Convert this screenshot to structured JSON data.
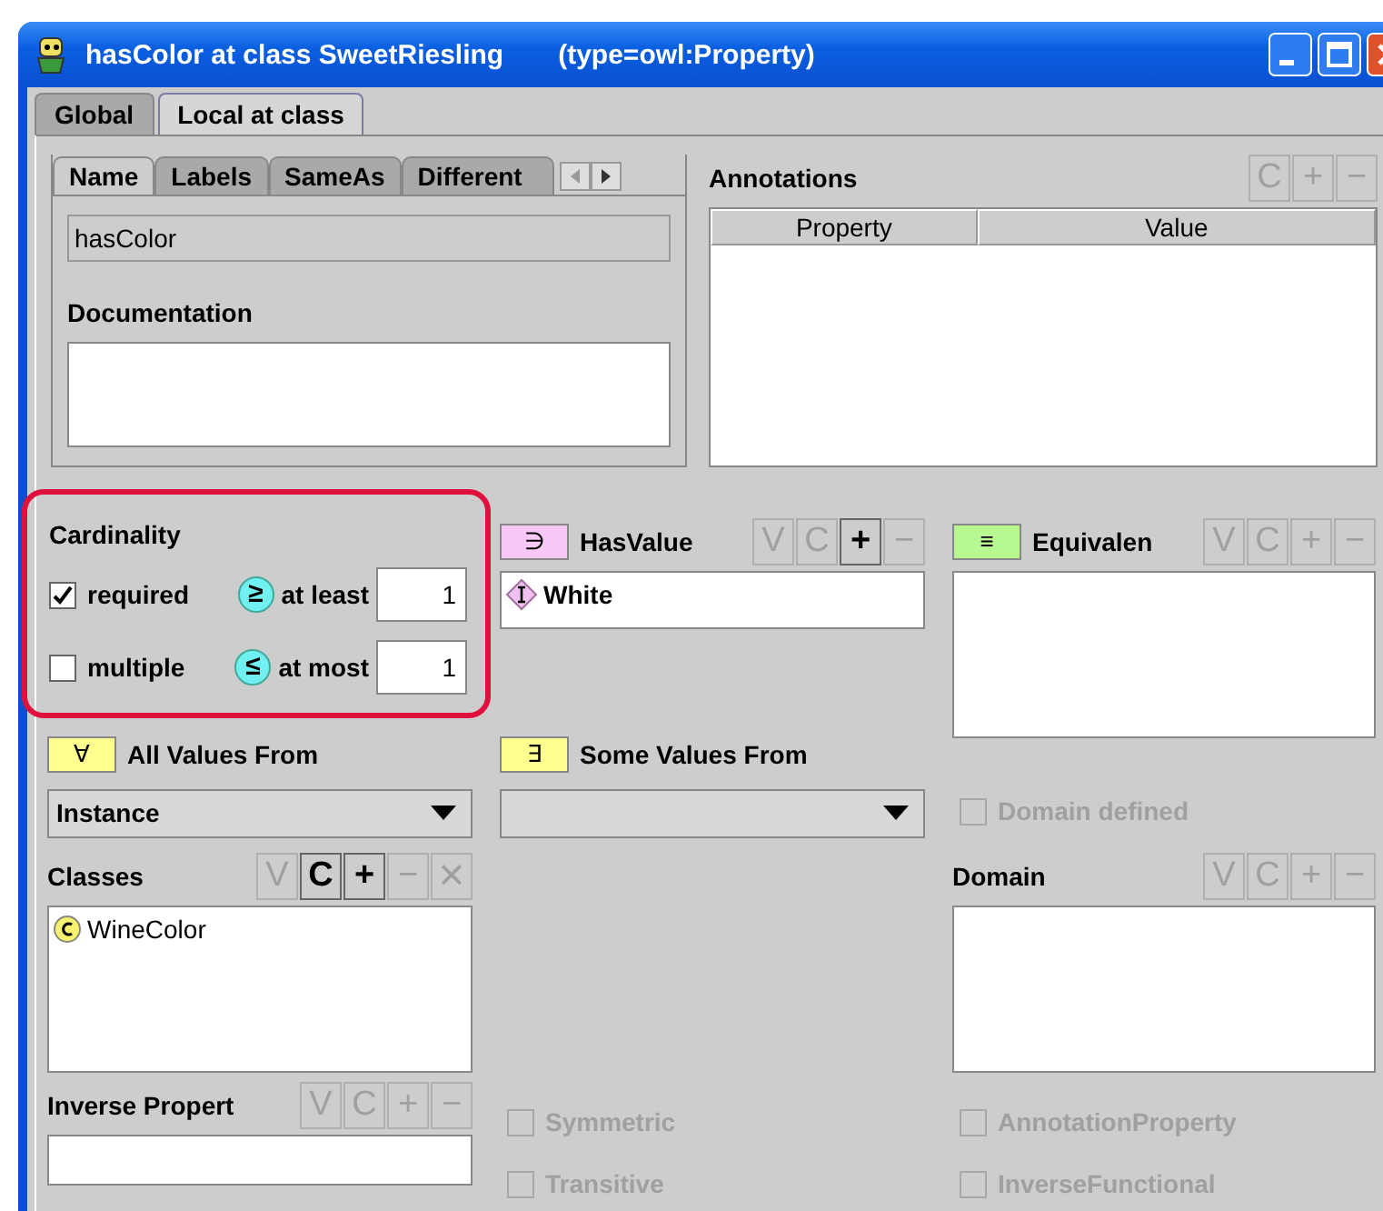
{
  "window": {
    "title": "hasColor at class SweetRiesling",
    "type_label": "(type=owl:Property)"
  },
  "scope_tabs": [
    {
      "label": "Global",
      "selected": false
    },
    {
      "label": "Local at class",
      "selected": true
    }
  ],
  "name_tabs": [
    {
      "label": "Name",
      "selected": true
    },
    {
      "label": "Labels",
      "selected": false
    },
    {
      "label": "SameAs",
      "selected": false
    },
    {
      "label": "Different",
      "selected": false
    }
  ],
  "name_field": {
    "value": "hasColor"
  },
  "documentation": {
    "label": "Documentation"
  },
  "annotations": {
    "label": "Annotations",
    "buttons": [
      {
        "label": "C",
        "disabled": true
      },
      {
        "label": "+",
        "disabled": true
      },
      {
        "label": "−",
        "disabled": true
      }
    ],
    "columns": [
      "Property",
      "Value"
    ]
  },
  "cardinality": {
    "label": "Cardinality",
    "rows": [
      {
        "label": "required",
        "checked": true,
        "symbol": "≥",
        "bound_label": "at least",
        "value": "1"
      },
      {
        "label": "multiple",
        "checked": false,
        "symbol": "≤",
        "bound_label": "at most",
        "value": "1"
      }
    ]
  },
  "has_value": {
    "symbol": "∋",
    "color": "#f8c8f8",
    "label": "HasValue",
    "buttons": [
      {
        "label": "V",
        "disabled": true
      },
      {
        "label": "C",
        "disabled": true
      },
      {
        "label": "+",
        "disabled": false
      },
      {
        "label": "−",
        "disabled": true
      }
    ],
    "items": [
      "White"
    ]
  },
  "equivalent": {
    "symbol": "≡",
    "color": "#b8f890",
    "label": "Equivalen",
    "buttons": [
      {
        "label": "V",
        "disabled": true
      },
      {
        "label": "C",
        "disabled": true
      },
      {
        "label": "+",
        "disabled": true
      },
      {
        "label": "−",
        "disabled": true
      }
    ]
  },
  "all_values_from": {
    "symbol": "∀",
    "color": "#ffff90",
    "label": "All Values From",
    "value": "Instance"
  },
  "some_values_from": {
    "symbol": "∃",
    "color": "#ffff90",
    "label": "Some Values From"
  },
  "domain_defined": {
    "label": "Domain defined",
    "checked": false,
    "disabled": true
  },
  "classes": {
    "label": "Classes",
    "buttons": [
      {
        "label": "V",
        "disabled": true
      },
      {
        "label": "C",
        "disabled": false
      },
      {
        "label": "+",
        "disabled": false
      },
      {
        "label": "−",
        "disabled": true
      },
      {
        "label": "✕",
        "disabled": true
      }
    ],
    "items": [
      "WineColor"
    ]
  },
  "domain": {
    "label": "Domain",
    "buttons": [
      {
        "label": "V",
        "disabled": true
      },
      {
        "label": "C",
        "disabled": true
      },
      {
        "label": "+",
        "disabled": true
      },
      {
        "label": "−",
        "disabled": true
      }
    ]
  },
  "inverse_property": {
    "label": "Inverse Propert",
    "buttons": [
      {
        "label": "V",
        "disabled": true
      },
      {
        "label": "C",
        "disabled": true
      },
      {
        "label": "+",
        "disabled": true
      },
      {
        "label": "−",
        "disabled": true
      }
    ]
  },
  "flags_middle": [
    {
      "label": "Symmetric",
      "checked": false,
      "disabled": true
    },
    {
      "label": "Transitive",
      "checked": false,
      "disabled": true
    }
  ],
  "flags_right": [
    {
      "label": "AnnotationProperty",
      "checked": false,
      "disabled": true
    },
    {
      "label": "InverseFunctional",
      "checked": false,
      "disabled": true
    }
  ]
}
